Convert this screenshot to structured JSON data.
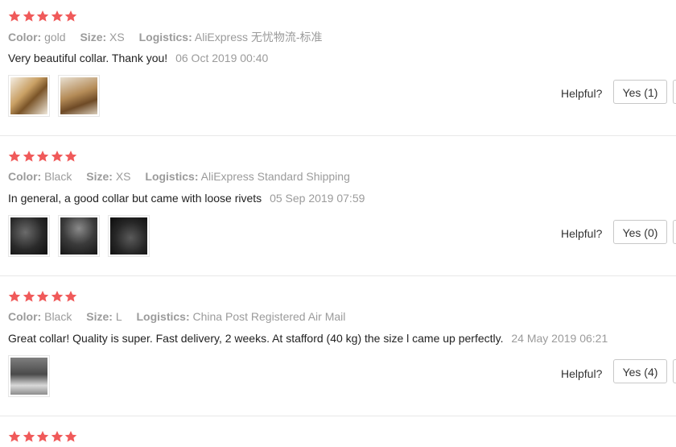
{
  "colors": {
    "star": "#f05a5a",
    "muted": "#9b9b9b",
    "text": "#222222",
    "divider": "#e8e8e8"
  },
  "labels": {
    "color": "Color:",
    "size": "Size:",
    "logistics": "Logistics:",
    "helpful": "Helpful?"
  },
  "reviews": [
    {
      "rating": 5,
      "color": "gold",
      "size": "XS",
      "logistics": "AliExpress 无忧物流-标准",
      "text": "Very beautiful collar. Thank you!",
      "date": "06 Oct 2019 00:40",
      "yes_label": "Yes (1)",
      "photos": [
        "collar-photo",
        "collar-photo"
      ]
    },
    {
      "rating": 5,
      "color": "Black",
      "size": "XS",
      "logistics": "AliExpress Standard Shipping",
      "text": "In general, a good collar but came with loose rivets",
      "date": "05 Sep 2019 07:59",
      "yes_label": "Yes (0)",
      "photos": [
        "collar-photo",
        "collar-photo",
        "collar-photo"
      ]
    },
    {
      "rating": 5,
      "color": "Black",
      "size": "L",
      "logistics": "China Post Registered Air Mail",
      "text": "Great collar! Quality is super. Fast delivery, 2 weeks. At stafford (40 kg) the size l came up perfectly.",
      "date": "24 May 2019 06:21",
      "yes_label": "Yes (4)",
      "photos": [
        "dog-photo"
      ]
    },
    {
      "rating": 5
    }
  ]
}
